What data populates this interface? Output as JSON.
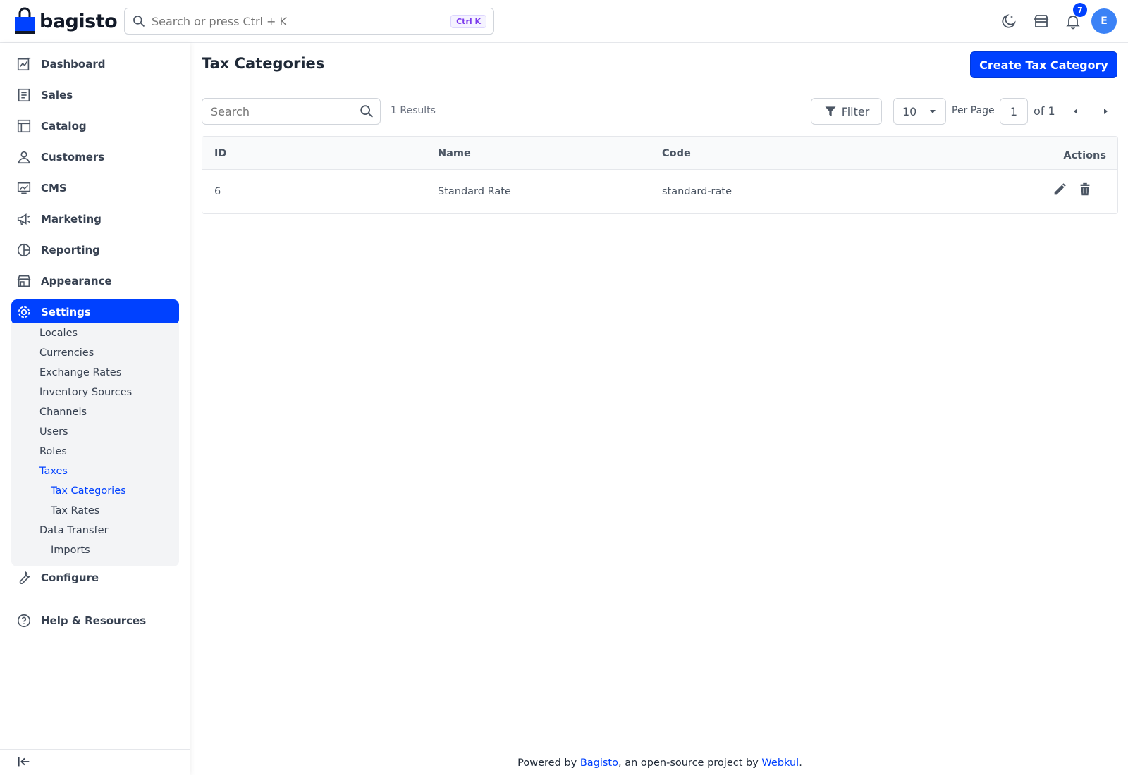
{
  "brand": {
    "name": "bagisto"
  },
  "global_search": {
    "placeholder": "Search or press Ctrl + K",
    "shortcut": "Ctrl K"
  },
  "header": {
    "notification_count": "7",
    "avatar_initial": "E"
  },
  "sidebar": {
    "items": [
      {
        "label": "Dashboard",
        "icon": "dashboard-icon"
      },
      {
        "label": "Sales",
        "icon": "receipt-icon"
      },
      {
        "label": "Catalog",
        "icon": "catalog-icon"
      },
      {
        "label": "Customers",
        "icon": "user-icon"
      },
      {
        "label": "CMS",
        "icon": "monitor-icon"
      },
      {
        "label": "Marketing",
        "icon": "megaphone-icon"
      },
      {
        "label": "Reporting",
        "icon": "pie-chart-icon"
      },
      {
        "label": "Appearance",
        "icon": "store-icon"
      },
      {
        "label": "Settings",
        "icon": "gear-icon",
        "active": true
      }
    ],
    "settings_sub": {
      "locales": "Locales",
      "currencies": "Currencies",
      "exchange_rates": "Exchange Rates",
      "inventory_sources": "Inventory Sources",
      "channels": "Channels",
      "users": "Users",
      "roles": "Roles",
      "taxes": "Taxes",
      "tax_categories": "Tax Categories",
      "tax_rates": "Tax Rates",
      "data_transfer": "Data Transfer",
      "imports": "Imports"
    },
    "configure": "Configure",
    "help": "Help & Resources"
  },
  "page": {
    "title": "Tax Categories",
    "create_button": "Create Tax Category"
  },
  "datagrid": {
    "search_placeholder": "Search",
    "results": "1 Results",
    "filter_label": "Filter",
    "per_page_value": "10",
    "per_page_label": "Per Page",
    "current_page": "1",
    "page_of": "of 1",
    "columns": {
      "id": "ID",
      "name": "Name",
      "code": "Code",
      "actions": "Actions"
    },
    "rows": [
      {
        "id": "6",
        "name": "Standard Rate",
        "code": "standard-rate"
      }
    ]
  },
  "footer": {
    "prefix": "Powered by ",
    "link1": "Bagisto",
    "middle": ", an open-source project by ",
    "link2": "Webkul",
    "suffix": "."
  },
  "colors": {
    "accent": "#0041ff",
    "text": "#1f2937",
    "muted": "#6b7280",
    "border": "#e5e7eb"
  }
}
